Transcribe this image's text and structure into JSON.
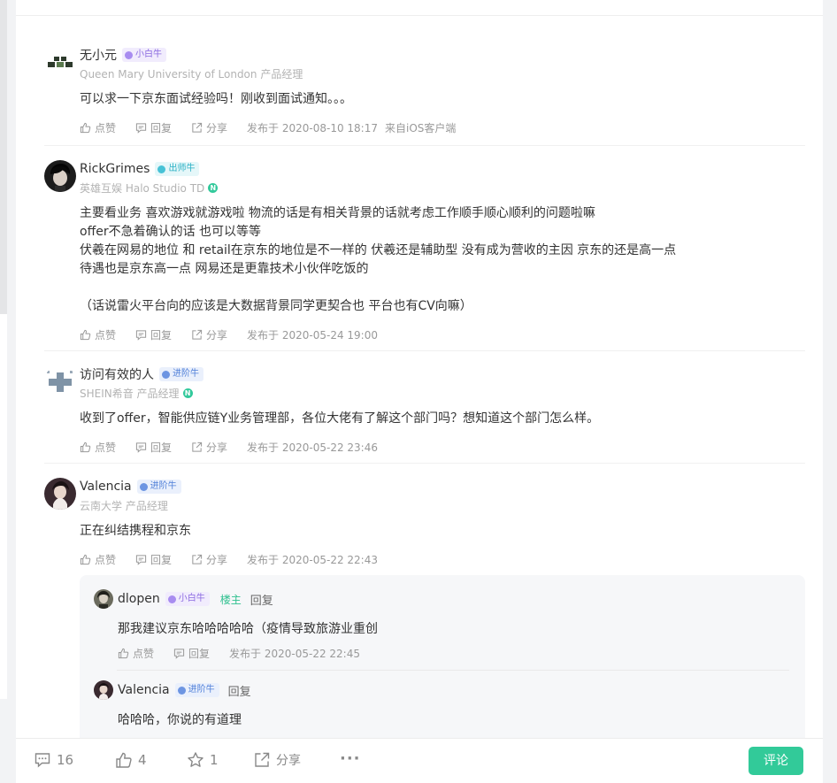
{
  "top_partial": "•••   ••   ••   •• ••",
  "comments": [
    {
      "name": "无小元",
      "badge": "小白牛",
      "sub": "Queen Mary University of London 产品经理",
      "text": "可以求一下京东面试经验吗！刚收到面试通知。。。",
      "like": "点赞",
      "reply": "回复",
      "share": "分享",
      "time": "发布于 2020-08-10 18:17",
      "client": "来自iOS客户端"
    },
    {
      "name": "RickGrimes",
      "badge": "出师牛",
      "sub": "英雄互娱  Halo Studio  TD",
      "text": "主要看业务 喜欢游戏就游戏啦 物流的话是有相关背景的话就考虑工作顺手顺心顺利的问题啦嘛\noffer不急着确认的话 也可以等等\n伏羲在网易的地位 和 retail在京东的地位是不一样的 伏羲还是辅助型 没有成为营收的主因 京东的还是高一点\n待遇也是京东高一点 网易还是更靠技术小伙伴吃饭的\n\n（话说雷火平台向的应该是大数据背景同学更契合也 平台也有CV向嘛）",
      "like": "点赞",
      "reply": "回复",
      "share": "分享",
      "time": "发布于 2020-05-24 19:00"
    },
    {
      "name": "访问有效的人",
      "badge": "进阶牛",
      "sub": "SHEIN希音  产品经理",
      "text": "收到了offer，智能供应链Y业务管理部，各位大佬有了解这个部门吗？想知道这个部门怎么样。",
      "like": "点赞",
      "reply": "回复",
      "share": "分享",
      "time": "发布于 2020-05-22 23:46"
    },
    {
      "name": "Valencia",
      "badge": "进阶牛",
      "sub": "云南大学 产品经理",
      "text": "正在纠结携程和京东",
      "like": "点赞",
      "reply": "回复",
      "share": "分享",
      "time": "发布于 2020-05-22 22:43"
    }
  ],
  "replies": [
    {
      "name": "dlopen",
      "badge": "小白牛",
      "owner": "楼主",
      "reply_label": "回复",
      "text": "那我建议京东哈哈哈哈哈（疫情导致旅游业重创",
      "like": "点赞",
      "reply": "回复",
      "time": "发布于 2020-05-22 22:45"
    },
    {
      "name": "Valencia",
      "badge": "进阶牛",
      "reply_label": "回复",
      "text": "哈哈哈，你说的有道理"
    }
  ],
  "bottom": {
    "comments": "16",
    "likes": "4",
    "stars": "1",
    "share": "分享",
    "more": "···",
    "cta": "评论"
  },
  "colors": {
    "accent": "#32ca99",
    "badge_purple": "#8b6ae0",
    "badge_cyan": "#2ab0c5",
    "badge_blue": "#4f7fd8"
  }
}
